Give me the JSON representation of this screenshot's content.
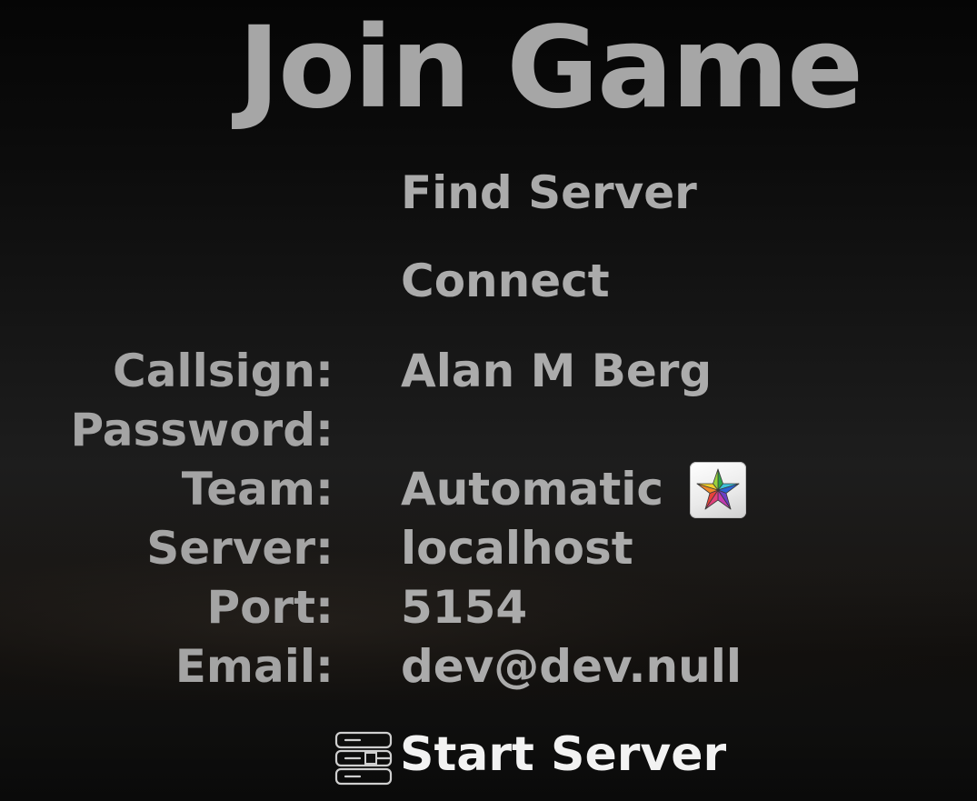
{
  "screen": {
    "title": "Join Game"
  },
  "menu": {
    "find_server": "Find Server",
    "connect": "Connect",
    "start_server": "Start Server"
  },
  "form": {
    "callsign": {
      "label": "Callsign:",
      "value": "Alan M Berg"
    },
    "password": {
      "label": "Password:",
      "value": ""
    },
    "team": {
      "label": "Team:",
      "value": "Automatic",
      "icon": "rainbow-star-icon"
    },
    "server": {
      "label": "Server:",
      "value": "localhost"
    },
    "port": {
      "label": "Port:",
      "value": "5154"
    },
    "email": {
      "label": "Email:",
      "value": "dev@dev.null"
    }
  },
  "icons": {
    "start_server": "server-rack-icon"
  },
  "colors": {
    "text": "#a8a8a8",
    "highlight": "#f2f2f2",
    "background": "#101010"
  }
}
